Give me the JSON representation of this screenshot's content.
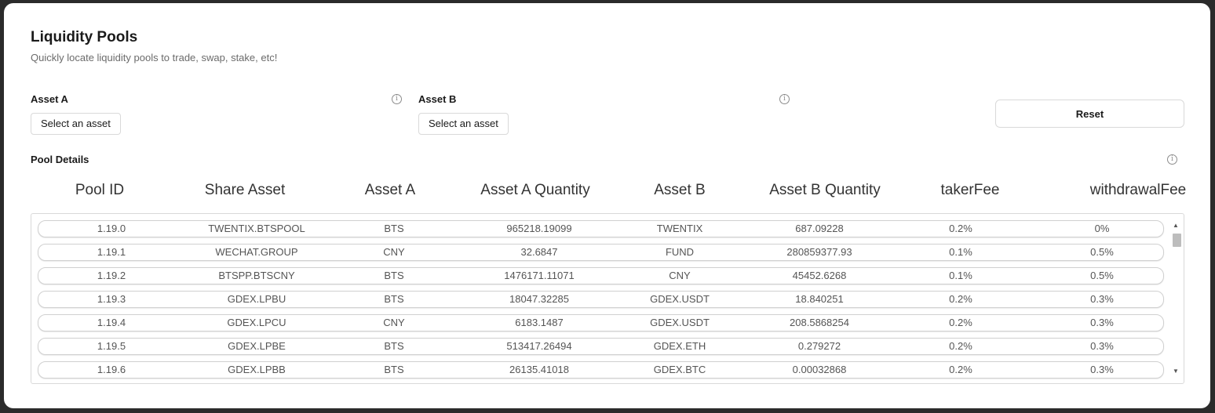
{
  "header": {
    "title": "Liquidity Pools",
    "subtitle": "Quickly locate liquidity pools to trade, swap, stake, etc!"
  },
  "filters": {
    "asset_a_label": "Asset A",
    "asset_a_button": "Select an asset",
    "asset_b_label": "Asset B",
    "asset_b_button": "Select an asset",
    "reset_label": "Reset",
    "info_glyph": "i"
  },
  "pool_details": {
    "label": "Pool Details",
    "columns": [
      "Pool ID",
      "Share Asset",
      "Asset A",
      "Asset A Quantity",
      "Asset B",
      "Asset B Quantity",
      "takerFee",
      "withdrawalFee"
    ],
    "rows": [
      [
        "1.19.0",
        "TWENTIX.BTSPOOL",
        "BTS",
        "965218.19099",
        "TWENTIX",
        "687.09228",
        "0.2%",
        "0%"
      ],
      [
        "1.19.1",
        "WECHAT.GROUP",
        "CNY",
        "32.6847",
        "FUND",
        "280859377.93",
        "0.1%",
        "0.5%"
      ],
      [
        "1.19.2",
        "BTSPP.BTSCNY",
        "BTS",
        "1476171.11071",
        "CNY",
        "45452.6268",
        "0.1%",
        "0.5%"
      ],
      [
        "1.19.3",
        "GDEX.LPBU",
        "BTS",
        "18047.32285",
        "GDEX.USDT",
        "18.840251",
        "0.2%",
        "0.3%"
      ],
      [
        "1.19.4",
        "GDEX.LPCU",
        "CNY",
        "6183.1487",
        "GDEX.USDT",
        "208.5868254",
        "0.2%",
        "0.3%"
      ],
      [
        "1.19.5",
        "GDEX.LPBE",
        "BTS",
        "513417.26494",
        "GDEX.ETH",
        "0.279272",
        "0.2%",
        "0.3%"
      ],
      [
        "1.19.6",
        "GDEX.LPBB",
        "BTS",
        "26135.41018",
        "GDEX.BTC",
        "0.00032868",
        "0.2%",
        "0.3%"
      ]
    ]
  }
}
